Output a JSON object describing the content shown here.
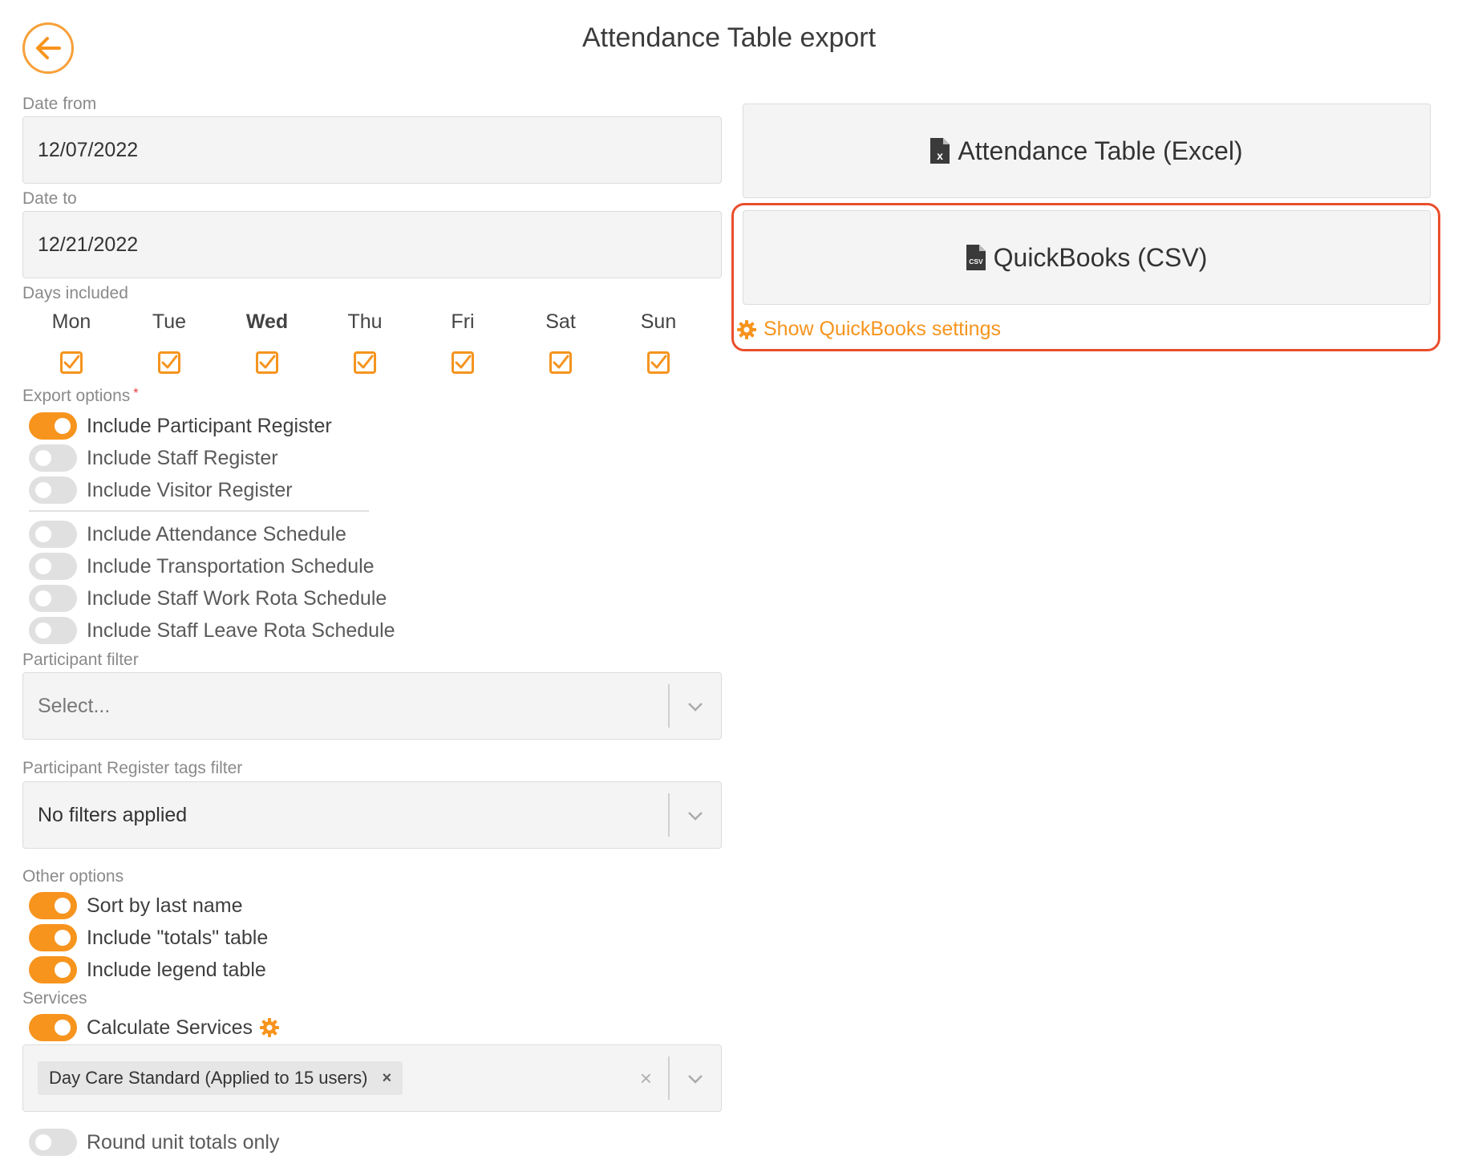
{
  "header": {
    "title": "Attendance Table export",
    "back_icon": "arrow-left-icon"
  },
  "date_from": {
    "label": "Date from",
    "value": "12/07/2022"
  },
  "date_to": {
    "label": "Date to",
    "value": "12/21/2022"
  },
  "days": {
    "label": "Days included",
    "items": [
      {
        "name": "Mon",
        "checked": true
      },
      {
        "name": "Tue",
        "checked": true
      },
      {
        "name": "Wed",
        "checked": true
      },
      {
        "name": "Thu",
        "checked": true
      },
      {
        "name": "Fri",
        "checked": true
      },
      {
        "name": "Sat",
        "checked": true
      },
      {
        "name": "Sun",
        "checked": true
      }
    ]
  },
  "export_options": {
    "label": "Export options",
    "required_mark": "*",
    "toggles": [
      {
        "label": "Include Participant Register",
        "on": true
      },
      {
        "label": "Include Staff Register",
        "on": false
      },
      {
        "label": "Include Visitor Register",
        "on": false
      },
      {
        "label": "Include Attendance Schedule",
        "on": false
      },
      {
        "label": "Include Transportation Schedule",
        "on": false
      },
      {
        "label": "Include Staff Work Rota Schedule",
        "on": false
      },
      {
        "label": "Include Staff Leave Rota Schedule",
        "on": false
      }
    ]
  },
  "participant_filter": {
    "label": "Participant filter",
    "placeholder": "Select..."
  },
  "tags_filter": {
    "label": "Participant Register tags filter",
    "value": "No filters applied"
  },
  "other_options": {
    "label": "Other options",
    "toggles": [
      {
        "label": "Sort by last name",
        "on": true
      },
      {
        "label": "Include \"totals\" table",
        "on": true
      },
      {
        "label": "Include legend table",
        "on": true
      }
    ]
  },
  "services": {
    "label": "Services",
    "calculate": {
      "label": "Calculate Services",
      "on": true
    },
    "selected_tag": "Day Care Standard (Applied to 15 users)",
    "tag_remove": "×",
    "clear": "×",
    "round": {
      "label": "Round unit totals only",
      "on": false
    }
  },
  "exports": {
    "excel": {
      "label": "Attendance Table (Excel)",
      "icon": "file-excel-icon"
    },
    "quickbooks": {
      "label": "QuickBooks (CSV)",
      "icon": "file-csv-icon"
    },
    "qb_settings": {
      "label": "Show QuickBooks settings",
      "icon": "gear-icon"
    }
  },
  "colors": {
    "accent": "#f7941d",
    "highlight": "#ea4e2c",
    "field_bg": "#f4f4f4"
  }
}
